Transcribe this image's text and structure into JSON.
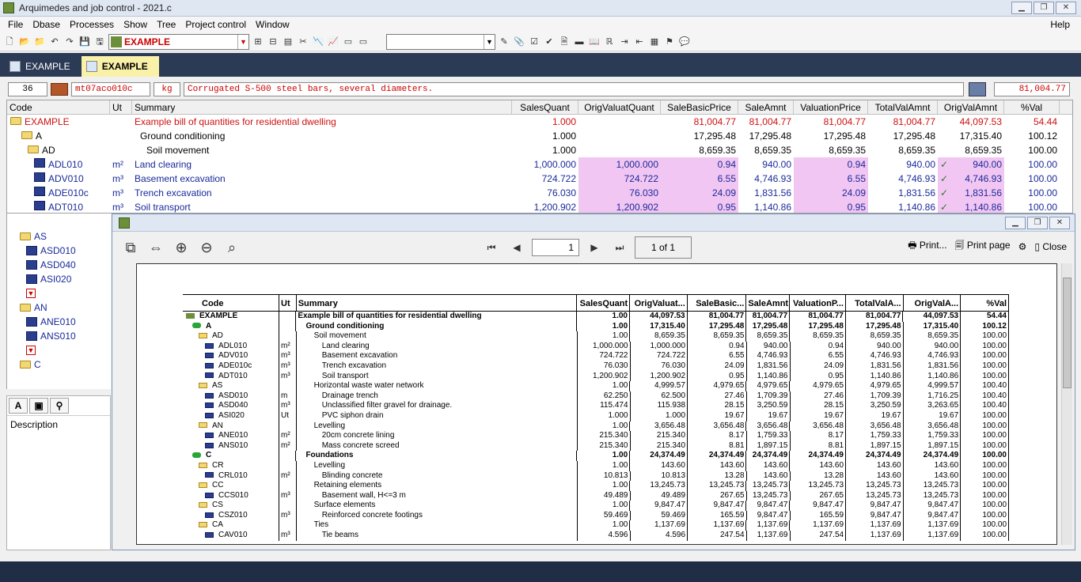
{
  "app": {
    "title": "Arquimedes and job control - 2021.c"
  },
  "menu": [
    "File",
    "Dbase",
    "Processes",
    "Show",
    "Tree",
    "Project control",
    "Window"
  ],
  "help": "Help",
  "toolbar": {
    "project_combo": "EXAMPLE"
  },
  "tabs": [
    {
      "label": "EXAMPLE"
    },
    {
      "label": "EXAMPLE"
    }
  ],
  "entry": {
    "number": "36",
    "code": "mt07aco010c",
    "unit": "kg",
    "summary": "Corrugated S-500 steel bars, several diameters.",
    "total": "81,004.77"
  },
  "grid": {
    "headers": [
      "Code",
      "Ut",
      "Summary",
      "SalesQuant",
      "OrigValuatQuant",
      "SaleBasicPrice",
      "SaleAmnt",
      "ValuationPrice",
      "TotalValAmnt",
      "OrigValAmnt",
      "%Val"
    ],
    "rows": [
      {
        "code": "EXAMPLE",
        "ut": "",
        "summary": "Example bill of quantities for residential dwelling",
        "sq": "1.000",
        "oq": "",
        "sbp": "81,004.77",
        "sa": "81,004.77",
        "vp": "81,004.77",
        "tva": "81,004.77",
        "ova": "44,097.53",
        "pv": "54.44",
        "style": "root"
      },
      {
        "code": "A",
        "ut": "",
        "summary": "Ground conditioning",
        "sq": "1.000",
        "oq": "",
        "sbp": "17,295.48",
        "sa": "17,295.48",
        "vp": "17,295.48",
        "tva": "17,295.48",
        "ova": "17,315.40",
        "pv": "100.12",
        "style": "ch"
      },
      {
        "code": "AD",
        "ut": "",
        "summary": "Soil movement",
        "sq": "1.000",
        "oq": "",
        "sbp": "8,659.35",
        "sa": "8,659.35",
        "vp": "8,659.35",
        "tva": "8,659.35",
        "ova": "8,659.35",
        "pv": "100.00",
        "style": "ch"
      },
      {
        "code": "ADL010",
        "ut": "m²",
        "summary": "Land clearing",
        "sq": "1,000.000",
        "oq": "1,000.000",
        "sbp": "0.94",
        "sa": "940.00",
        "vp": "0.94",
        "tva": "940.00",
        "ova": "940.00",
        "pv": "100.00",
        "style": "leaf"
      },
      {
        "code": "ADV010",
        "ut": "m³",
        "summary": "Basement excavation",
        "sq": "724.722",
        "oq": "724.722",
        "sbp": "6.55",
        "sa": "4,746.93",
        "vp": "6.55",
        "tva": "4,746.93",
        "ova": "4,746.93",
        "pv": "100.00",
        "style": "leaf"
      },
      {
        "code": "ADE010c",
        "ut": "m³",
        "summary": "Trench excavation",
        "sq": "76.030",
        "oq": "76.030",
        "sbp": "24.09",
        "sa": "1,831.56",
        "vp": "24.09",
        "tva": "1,831.56",
        "ova": "1,831.56",
        "pv": "100.00",
        "style": "leaf"
      },
      {
        "code": "ADT010",
        "ut": "m³",
        "summary": "Soil transport",
        "sq": "1,200.902",
        "oq": "1,200.902",
        "sbp": "0.95",
        "sa": "1,140.86",
        "vp": "0.95",
        "tva": "1,140.86",
        "ova": "1,140.86",
        "pv": "100.00",
        "style": "leaf"
      }
    ]
  },
  "tree": [
    {
      "code": "AS",
      "kind": "folder"
    },
    {
      "code": "ASD010",
      "kind": "leaf"
    },
    {
      "code": "ASD040",
      "kind": "leaf"
    },
    {
      "code": "ASI020",
      "kind": "leaf"
    },
    {
      "code": "AN",
      "kind": "folder"
    },
    {
      "code": "ANE010",
      "kind": "leaf"
    },
    {
      "code": "ANS010",
      "kind": "leaf"
    },
    {
      "code": "C",
      "kind": "folder"
    }
  ],
  "desc": {
    "label": "Description"
  },
  "preview": {
    "page": "1",
    "of": "1 of 1",
    "print": "Print...",
    "print_page": "Print page",
    "close": "Close",
    "headers": [
      "Code",
      "Ut",
      "Summary",
      "SalesQuant",
      "OrigValuat...",
      "SaleBasic...",
      "SaleAmnt",
      "ValuationP...",
      "TotalValA...",
      "OrigValA...",
      "%Val"
    ],
    "rows": [
      {
        "c": "EXAMPLE",
        "u": "",
        "s": "Example bill of quantities for residential dwelling",
        "v": [
          "1.00",
          "44,097.53",
          "81,004.77",
          "81,004.77",
          "81,004.77",
          "81,004.77",
          "44,097.53",
          "54.44"
        ],
        "b": true,
        "lvl": 0
      },
      {
        "c": "A",
        "u": "",
        "s": "Ground conditioning",
        "v": [
          "1.00",
          "17,315.40",
          "17,295.48",
          "17,295.48",
          "17,295.48",
          "17,295.48",
          "17,315.40",
          "100.12"
        ],
        "b": true,
        "lvl": 1
      },
      {
        "c": "AD",
        "u": "",
        "s": "Soil movement",
        "v": [
          "1.00",
          "8,659.35",
          "8,659.35",
          "8,659.35",
          "8,659.35",
          "8,659.35",
          "8,659.35",
          "100.00"
        ],
        "lvl": 2
      },
      {
        "c": "ADL010",
        "u": "m²",
        "s": "Land clearing",
        "v": [
          "1,000.000",
          "1,000.000",
          "0.94",
          "940.00",
          "0.94",
          "940.00",
          "940.00",
          "100.00"
        ],
        "lvl": 3
      },
      {
        "c": "ADV010",
        "u": "m³",
        "s": "Basement excavation",
        "v": [
          "724.722",
          "724.722",
          "6.55",
          "4,746.93",
          "6.55",
          "4,746.93",
          "4,746.93",
          "100.00"
        ],
        "lvl": 3
      },
      {
        "c": "ADE010c",
        "u": "m³",
        "s": "Trench excavation",
        "v": [
          "76.030",
          "76.030",
          "24.09",
          "1,831.56",
          "24.09",
          "1,831.56",
          "1,831.56",
          "100.00"
        ],
        "lvl": 3
      },
      {
        "c": "ADT010",
        "u": "m³",
        "s": "Soil transport",
        "v": [
          "1,200.902",
          "1,200.902",
          "0.95",
          "1,140.86",
          "0.95",
          "1,140.86",
          "1,140.86",
          "100.00"
        ],
        "lvl": 3
      },
      {
        "c": "AS",
        "u": "",
        "s": "Horizontal waste water network",
        "v": [
          "1.00",
          "4,999.57",
          "4,979.65",
          "4,979.65",
          "4,979.65",
          "4,979.65",
          "4,999.57",
          "100.40"
        ],
        "lvl": 2
      },
      {
        "c": "ASD010",
        "u": "m",
        "s": "Drainage trench",
        "v": [
          "62.250",
          "62.500",
          "27.46",
          "1,709.39",
          "27.46",
          "1,709.39",
          "1,716.25",
          "100.40"
        ],
        "lvl": 3
      },
      {
        "c": "ASD040",
        "u": "m³",
        "s": "Unclassified filter gravel for drainage.",
        "v": [
          "115.474",
          "115.938",
          "28.15",
          "3,250.59",
          "28.15",
          "3,250.59",
          "3,263.65",
          "100.40"
        ],
        "lvl": 3
      },
      {
        "c": "ASI020",
        "u": "Ut",
        "s": "PVC siphon drain",
        "v": [
          "1.000",
          "1.000",
          "19.67",
          "19.67",
          "19.67",
          "19.67",
          "19.67",
          "100.00"
        ],
        "lvl": 3
      },
      {
        "c": "AN",
        "u": "",
        "s": "Levelling",
        "v": [
          "1.00",
          "3,656.48",
          "3,656.48",
          "3,656.48",
          "3,656.48",
          "3,656.48",
          "3,656.48",
          "100.00"
        ],
        "lvl": 2
      },
      {
        "c": "ANE010",
        "u": "m²",
        "s": "20cm concrete lining",
        "v": [
          "215.340",
          "215.340",
          "8.17",
          "1,759.33",
          "8.17",
          "1,759.33",
          "1,759.33",
          "100.00"
        ],
        "lvl": 3
      },
      {
        "c": "ANS010",
        "u": "m²",
        "s": "Mass concrete screed",
        "v": [
          "215.340",
          "215.340",
          "8.81",
          "1,897.15",
          "8.81",
          "1,897.15",
          "1,897.15",
          "100.00"
        ],
        "lvl": 3
      },
      {
        "c": "C",
        "u": "",
        "s": "Foundations",
        "v": [
          "1.00",
          "24,374.49",
          "24,374.49",
          "24,374.49",
          "24,374.49",
          "24,374.49",
          "24,374.49",
          "100.00"
        ],
        "b": true,
        "lvl": 1
      },
      {
        "c": "CR",
        "u": "",
        "s": "Levelling",
        "v": [
          "1.00",
          "143.60",
          "143.60",
          "143.60",
          "143.60",
          "143.60",
          "143.60",
          "100.00"
        ],
        "lvl": 2
      },
      {
        "c": "CRL010",
        "u": "m²",
        "s": "Blinding concrete",
        "v": [
          "10.813",
          "10.813",
          "13.28",
          "143.60",
          "13.28",
          "143.60",
          "143.60",
          "100.00"
        ],
        "lvl": 3
      },
      {
        "c": "CC",
        "u": "",
        "s": "Retaining elements",
        "v": [
          "1.00",
          "13,245.73",
          "13,245.73",
          "13,245.73",
          "13,245.73",
          "13,245.73",
          "13,245.73",
          "100.00"
        ],
        "lvl": 2
      },
      {
        "c": "CCS010",
        "u": "m³",
        "s": "Basement wall, H<=3 m",
        "v": [
          "49.489",
          "49.489",
          "267.65",
          "13,245.73",
          "267.65",
          "13,245.73",
          "13,245.73",
          "100.00"
        ],
        "lvl": 3
      },
      {
        "c": "CS",
        "u": "",
        "s": "Surface elements",
        "v": [
          "1.00",
          "9,847.47",
          "9,847.47",
          "9,847.47",
          "9,847.47",
          "9,847.47",
          "9,847.47",
          "100.00"
        ],
        "lvl": 2
      },
      {
        "c": "CSZ010",
        "u": "m³",
        "s": "Reinforced concrete footings",
        "v": [
          "59.469",
          "59.469",
          "165.59",
          "9,847.47",
          "165.59",
          "9,847.47",
          "9,847.47",
          "100.00"
        ],
        "lvl": 3
      },
      {
        "c": "CA",
        "u": "",
        "s": "Ties",
        "v": [
          "1.00",
          "1,137.69",
          "1,137.69",
          "1,137.69",
          "1,137.69",
          "1,137.69",
          "1,137.69",
          "100.00"
        ],
        "lvl": 2
      },
      {
        "c": "CAV010",
        "u": "m³",
        "s": "Tie beams",
        "v": [
          "4.596",
          "4.596",
          "247.54",
          "1,137.69",
          "247.54",
          "1,137.69",
          "1,137.69",
          "100.00"
        ],
        "lvl": 3
      }
    ]
  }
}
